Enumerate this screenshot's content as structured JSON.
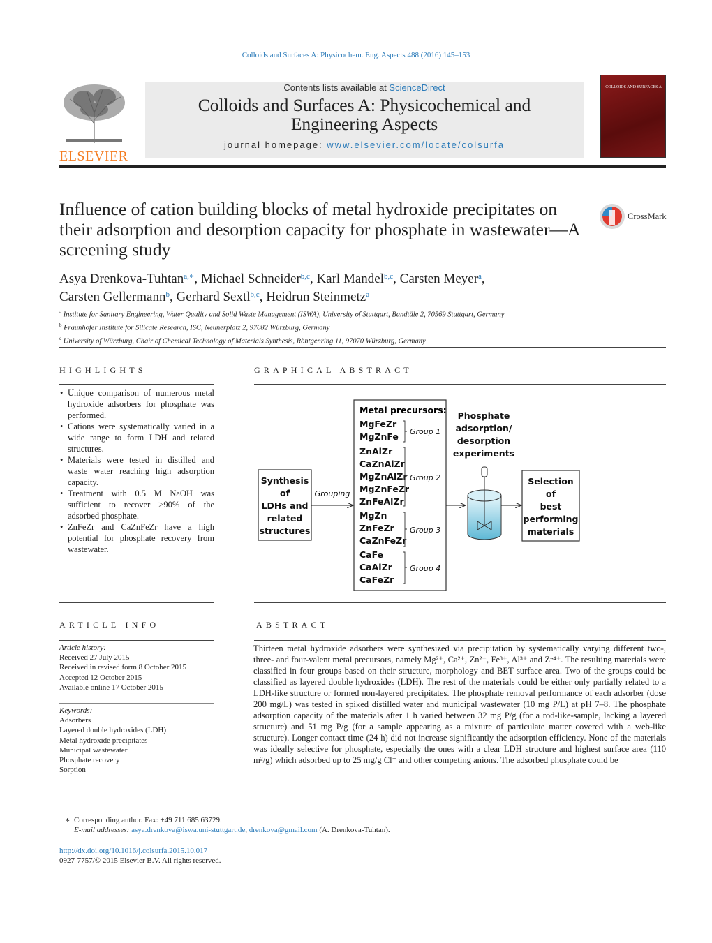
{
  "header": {
    "journal_ref": "Colloids and Surfaces A: Physicochem. Eng. Aspects 488 (2016) 145–153",
    "contents_prefix": "Contents lists available at ",
    "contents_link": "ScienceDirect",
    "journal_title_line1": "Colloids and Surfaces A: Physicochemical and",
    "journal_title_line2": "Engineering Aspects",
    "homepage_prefix": "journal homepage: ",
    "homepage_link": "www.elsevier.com/locate/colsurfa",
    "publisher_logo": "ELSEVIER",
    "cover_text": "COLLOIDS AND SURFACES A",
    "brand_color": "#f47c20",
    "link_color": "#2b7bb9"
  },
  "article": {
    "title": "Influence of cation building blocks of metal hydroxide precipitates on their adsorption and desorption capacity for phosphate in wastewater—A screening study",
    "crossmark_label": "CrossMark",
    "authors": [
      {
        "name": "Asya Drenkova-Tuhtan",
        "aff": "a,∗"
      },
      {
        "name": "Michael Schneider",
        "aff": "b,c"
      },
      {
        "name": "Karl Mandel",
        "aff": "b,c"
      },
      {
        "name": "Carsten Meyer",
        "aff": "a"
      },
      {
        "name": "Carsten Gellermann",
        "aff": "b"
      },
      {
        "name": "Gerhard Sextl",
        "aff": "b,c"
      },
      {
        "name": "Heidrun Steinmetz",
        "aff": "a"
      }
    ],
    "affiliations": [
      {
        "key": "a",
        "text": "Institute for Sanitary Engineering, Water Quality and Solid Waste Management (ISWA), University of Stuttgart, Bandtäle 2, 70569 Stuttgart, Germany"
      },
      {
        "key": "b",
        "text": "Fraunhofer Institute for Silicate Research, ISC, Neunerplatz 2, 97082 Würzburg, Germany"
      },
      {
        "key": "c",
        "text": "University of Würzburg, Chair of Chemical Technology of Materials Synthesis, Röntgenring 11, 97070 Würzburg, Germany"
      }
    ]
  },
  "highlights": {
    "heading": "HIGHLIGHTS",
    "items": [
      "Unique comparison of numerous metal hydroxide adsorbers for phosphate was performed.",
      "Cations were systematically varied in a wide range to form LDH and related structures.",
      "Materials were tested in distilled and waste water reaching high adsorption capacity.",
      "Treatment with 0.5 M NaOH was sufficient to recover >90% of the adsorbed phosphate.",
      "ZnFeZr and CaZnFeZr have a high potential for phosphate recovery from wastewater."
    ]
  },
  "graphical_abstract": {
    "heading": "GRAPHICAL ABSTRACT",
    "synthesis": [
      "Synthesis",
      "of",
      "LDHs and",
      "related",
      "structures"
    ],
    "grouping_label": "Grouping",
    "precursors_title": "Metal precursors:",
    "groups": [
      {
        "label": "Group 1",
        "items": [
          "MgFeZr",
          "MgZnFe"
        ]
      },
      {
        "label": "Group 2",
        "items": [
          "ZnAlZr",
          "CaZnAlZr",
          "MgZnAlZr",
          "MgZnFeZr",
          "ZnFeAlZr"
        ]
      },
      {
        "label": "Group 3",
        "items": [
          "MgZn",
          "ZnFeZr",
          "CaZnFeZr"
        ]
      },
      {
        "label": "Group 4",
        "items": [
          "CaFe",
          "CaAlZr",
          "CaFeZr"
        ]
      }
    ],
    "experiments": [
      "Phosphate",
      "adsorption/",
      "desorption",
      "experiments"
    ],
    "selection": [
      "Selection",
      "of",
      "best",
      "performing",
      "materials"
    ]
  },
  "article_info": {
    "heading": "ARTICLE INFO",
    "history_label": "Article history:",
    "history": [
      "Received 27 July 2015",
      "Received in revised form 8 October 2015",
      "Accepted 12 October 2015",
      "Available online 17 October 2015"
    ],
    "keywords_label": "Keywords:",
    "keywords": [
      "Adsorbers",
      "Layered double hydroxides (LDH)",
      "Metal hydroxide precipitates",
      "Municipal wastewater",
      "Phosphate recovery",
      "Sorption"
    ]
  },
  "abstract": {
    "heading": "ABSTRACT",
    "text": "Thirteen metal hydroxide adsorbers were synthesized via precipitation by systematically varying different two-, three- and four-valent metal precursors, namely Mg²⁺, Ca²⁺, Zn²⁺, Fe³⁺, Al³⁺ and Zr⁴⁺. The resulting materials were classified in four groups based on their structure, morphology and BET surface area. Two of the groups could be classified as layered double hydroxides (LDH). The rest of the materials could be either only partially related to a LDH-like structure or formed non-layered precipitates. The phosphate removal performance of each adsorber (dose 200 mg/L) was tested in spiked distilled water and municipal wastewater (10 mg P/L) at pH 7–8. The phosphate adsorption capacity of the materials after 1 h varied between 32 mg P/g (for a rod-like-sample, lacking a layered structure) and 51 mg P/g (for a sample appearing as a mixture of particulate matter covered with a web-like structure). Longer contact time (24 h) did not increase significantly the adsorption efficiency. None of the materials was ideally selective for phosphate, especially the ones with a clear LDH structure and highest surface area (110 m²/g) which adsorbed up to 25 mg/g Cl⁻ and other competing anions. The adsorbed phosphate could be"
  },
  "footer": {
    "corresponding": "Corresponding author. Fax: +49 711 685 63729.",
    "email_label": "E-mail addresses:",
    "email1": "asya.drenkova@iswa.uni-stuttgart.de",
    "email2": "drenkova@gmail.com",
    "email_suffix": " (A. Drenkova-Tuhtan).",
    "doi": "http://dx.doi.org/10.1016/j.colsurfa.2015.10.017",
    "copyright": "0927-7757/© 2015 Elsevier B.V. All rights reserved."
  }
}
